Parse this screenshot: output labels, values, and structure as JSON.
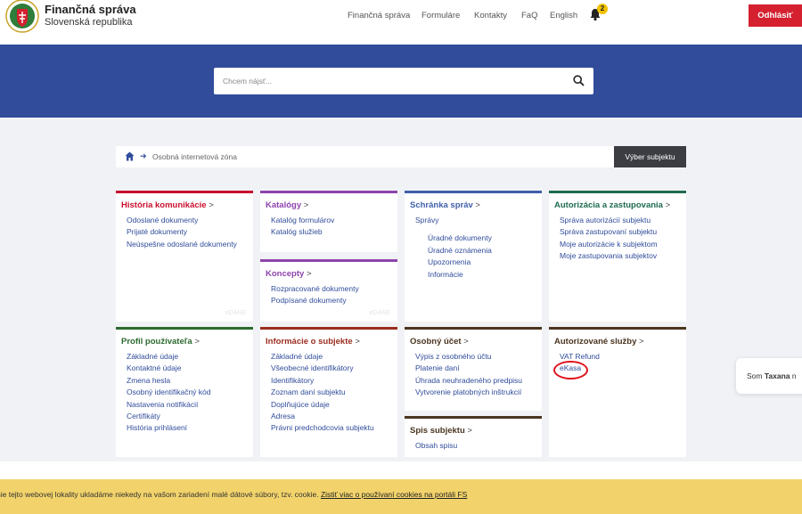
{
  "header": {
    "brand_title": "Finančná správa",
    "brand_subtitle": "Slovenská republika",
    "nav": [
      "Finančná správa",
      "Formuláre",
      "Kontakty",
      "FaQ",
      "English"
    ],
    "notification_count": "2",
    "logout_label": "Odhlásiť"
  },
  "search": {
    "placeholder": "Chcem nájsť..."
  },
  "breadcrumb": {
    "current": "Osobná internetová zóna",
    "select_subject_label": "Výber subjektu"
  },
  "cards": {
    "history": {
      "title": "História komunikácie",
      "items": [
        "Odoslané dokumenty",
        "Prijaté dokumenty",
        "Neúspešne odoslané dokumenty"
      ],
      "watermark": "eDANE"
    },
    "catalogs": {
      "title": "Katalógy",
      "items": [
        "Katalóg formulárov",
        "Katalóg služieb"
      ]
    },
    "drafts": {
      "title": "Koncepty",
      "items": [
        "Rozpracované dokumenty",
        "Podpísané dokumenty"
      ],
      "watermark": "eDANE"
    },
    "mailbox": {
      "title": "Schránka správ",
      "group": "Správy",
      "items": [
        "Úradné dokumenty",
        "Úradné oznámenia",
        "Upozornenia",
        "Informácie"
      ]
    },
    "authorization": {
      "title": "Autorizácia a zastupovania",
      "items": [
        "Správa autorizácií subjektu",
        "Správa zastupovaní subjektu",
        "Moje autorizácie k subjektom",
        "Moje zastupovania subjektov"
      ]
    },
    "profile": {
      "title": "Profil používateľa",
      "items": [
        "Základné údaje",
        "Kontaktné údaje",
        "Zmena hesla",
        "Osobný identifikačný kód",
        "Nastavenia notifikácií",
        "Certifikáty",
        "História prihlásení"
      ]
    },
    "subject_info": {
      "title": "Informácie o subjekte",
      "items": [
        "Základné údaje",
        "Všeobecné identifikátory",
        "Identifikátory",
        "Zoznam daní subjektu",
        "Doplňujúce údaje",
        "Adresa",
        "Právni predchodcovia subjektu"
      ]
    },
    "personal_account": {
      "title": "Osobný účet",
      "items": [
        "Výpis z osobného účtu",
        "Platenie daní",
        "Úhrada neuhradeného predpisu",
        "Vytvorenie platobných inštrukcií"
      ]
    },
    "subject_file": {
      "title": "Spis subjektu",
      "items": [
        "Obsah spisu"
      ]
    },
    "authorized_services": {
      "title": "Autorizované služby",
      "items": [
        "VAT Refund",
        "eKasa"
      ]
    }
  },
  "chat": {
    "prefix": "Som ",
    "name": "Taxana",
    "suffix": " n"
  },
  "cookie": {
    "text": "nie tejto webovej lokality ukladáme niekedy na vašom zariadení malé dátové súbory, tzv. cookie. ",
    "link": "Zistiť viac o používaní cookies na portáli FS"
  },
  "colors": {
    "hero": "#304c9b",
    "logout": "#d4202f",
    "history": "#c8102e",
    "catalogs": "#8e44ad",
    "mailbox": "#3f5fa8",
    "authorization": "#1e6b4e",
    "profile": "#2c6a2e",
    "subject_info": "#9a2d1f",
    "personal_account": "#4a3520",
    "cookie_bar": "#f2d36b"
  }
}
